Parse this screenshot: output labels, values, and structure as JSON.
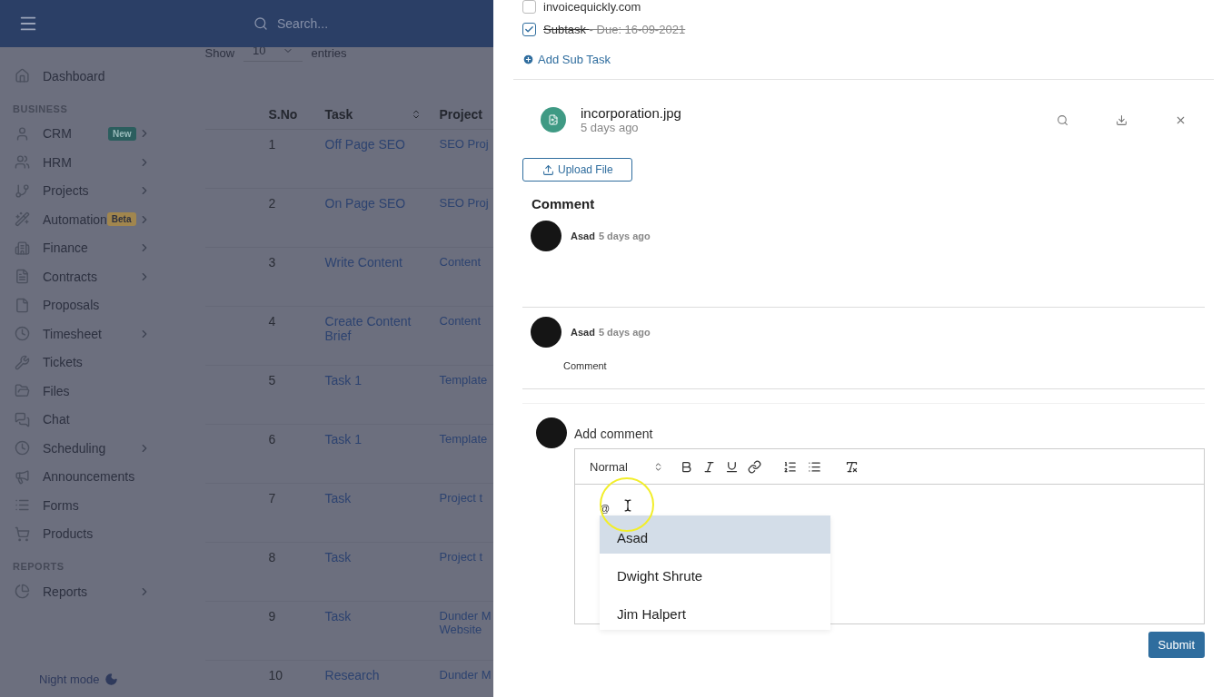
{
  "header": {
    "search": {
      "placeholder": "Search..."
    }
  },
  "sidebar": {
    "top_items": [
      {
        "label": "Dashboard",
        "submenu": false
      }
    ],
    "sections": [
      {
        "title": "BUSINESS",
        "items": [
          {
            "label": "CRM",
            "submenu": true,
            "badge": {
              "text": "New",
              "kind": "new"
            }
          },
          {
            "label": "HRM",
            "submenu": true
          },
          {
            "label": "Projects",
            "submenu": true
          },
          {
            "label": "Automation",
            "submenu": true,
            "badge": {
              "text": "Beta",
              "kind": "beta"
            }
          },
          {
            "label": "Finance",
            "submenu": true
          },
          {
            "label": "Contracts",
            "submenu": true
          },
          {
            "label": "Proposals",
            "submenu": false
          },
          {
            "label": "Timesheet",
            "submenu": true
          },
          {
            "label": "Tickets",
            "submenu": false
          },
          {
            "label": "Files",
            "submenu": false
          },
          {
            "label": "Chat",
            "submenu": false
          },
          {
            "label": "Scheduling",
            "submenu": true
          },
          {
            "label": "Announcements",
            "submenu": false
          },
          {
            "label": "Forms",
            "submenu": false
          },
          {
            "label": "Products",
            "submenu": false
          }
        ]
      },
      {
        "title": "REPORTS",
        "items": [
          {
            "label": "Reports",
            "submenu": true
          }
        ]
      }
    ],
    "night_mode": "Night mode"
  },
  "table": {
    "length": {
      "show": "Show",
      "value": "10",
      "entries": "entries"
    },
    "columns": [
      "S.No",
      "Task",
      "Project"
    ],
    "rows": [
      {
        "sno": "1",
        "task": "Off Page SEO",
        "project": "SEO Proj"
      },
      {
        "sno": "2",
        "task": "On Page SEO",
        "project": "SEO Proj"
      },
      {
        "sno": "3",
        "task": "Write Content",
        "project": "Content"
      },
      {
        "sno": "4",
        "task": "Create Content Brief",
        "project": "Content"
      },
      {
        "sno": "5",
        "task": "Task 1",
        "project": "Template"
      },
      {
        "sno": "6",
        "task": "Task 1",
        "project": "Template"
      },
      {
        "sno": "7",
        "task": "Task",
        "project": "Project t"
      },
      {
        "sno": "8",
        "task": "Task",
        "project": "Project t"
      },
      {
        "sno": "9",
        "task": "Task",
        "project": "Dunder M Website"
      },
      {
        "sno": "10",
        "task": "Research",
        "project": "Dunder M"
      }
    ]
  },
  "panel": {
    "subtasks": [
      {
        "title": "invoicequickly.com",
        "checked": false
      },
      {
        "title": "Subtask",
        "due": "- Due: 16-09-2021",
        "checked": true
      }
    ],
    "add_subtask": "Add Sub Task",
    "files": [
      {
        "name": "incorporation.jpg",
        "time": "5 days ago"
      }
    ],
    "upload": "Upload File",
    "comments_title": "Comment",
    "comments": [
      {
        "author": "Asad",
        "time": "5 days ago"
      },
      {
        "author": "Asad",
        "time": "5 days ago",
        "text": "Comment"
      }
    ],
    "new_comment": {
      "label": "Add comment",
      "format": "Normal",
      "typed": "@",
      "mentions": [
        {
          "name": "Asad",
          "selected": true
        },
        {
          "name": "Dwight Shrute",
          "selected": false
        },
        {
          "name": "Jim Halpert",
          "selected": false
        }
      ],
      "submit": "Submit"
    }
  }
}
